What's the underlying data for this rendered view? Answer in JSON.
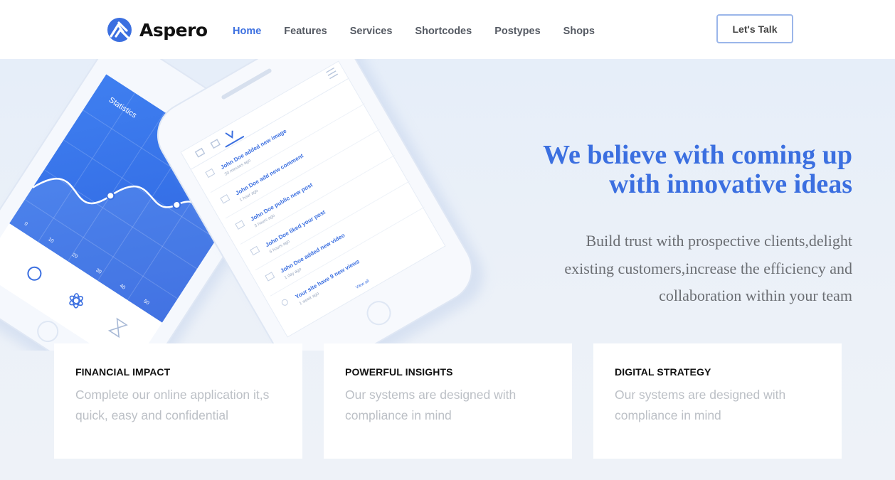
{
  "brand": {
    "name": "Aspero",
    "color": "#3b6fe0",
    "icon": "aspero-logo-icon"
  },
  "nav": {
    "items": [
      {
        "label": "Home",
        "active": true
      },
      {
        "label": "Features",
        "active": false
      },
      {
        "label": "Services",
        "active": false
      },
      {
        "label": "Shortcodes",
        "active": false
      },
      {
        "label": "Postypes",
        "active": false
      },
      {
        "label": "Shops",
        "active": false
      }
    ]
  },
  "cta": {
    "label": "Let's Talk"
  },
  "hero": {
    "headline_line1": "We believe with coming up",
    "headline_line2": "with innovative ideas",
    "subtext_line1": "Build trust with prospective clients,delight",
    "subtext_line2": "existing customers,increase the efficiency and",
    "subtext_line3": "collaboration within your team"
  },
  "phone_left": {
    "title": "Statistics",
    "axis": [
      "0",
      "10",
      "20",
      "30",
      "40",
      "50"
    ]
  },
  "phone_right": {
    "feed": [
      {
        "text": "John Doe added new image",
        "time": "30 minutes ago"
      },
      {
        "text": "John Doe add new comment",
        "time": "1 hour ago"
      },
      {
        "text": "John Doe public new post",
        "time": "3 hours ago"
      },
      {
        "text": "John Doe liked your post",
        "time": "6 hours ago"
      },
      {
        "text": "John Doe added new video",
        "time": "1 day ago"
      },
      {
        "text": "Your site have 9 new views",
        "time": "1 week ago"
      }
    ],
    "view_all": "View all"
  },
  "cards": [
    {
      "title": "FINANCIAL IMPACT",
      "line1": "Complete our online application it,s",
      "line2": "quick, easy and confidential"
    },
    {
      "title": "POWERFUL INSIGHTS",
      "line1": "Our systems are designed with",
      "line2": "compliance in mind"
    },
    {
      "title": "DIGITAL STRATEGY",
      "line1": "Our systems are designed with",
      "line2": "compliance in mind"
    }
  ],
  "colors": {
    "accent": "#3b6fe0",
    "background": "#ebf1f9",
    "card_text": "#bcc0c6"
  }
}
